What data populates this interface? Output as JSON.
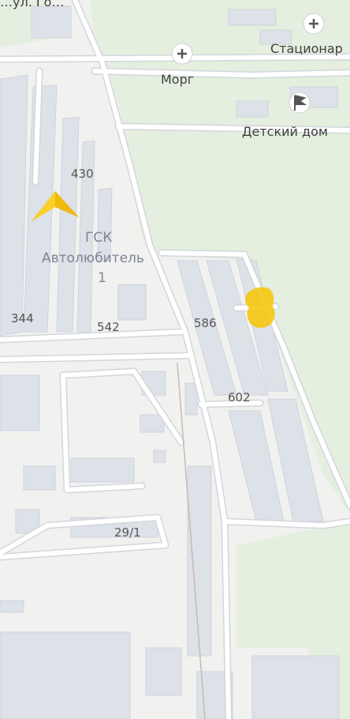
{
  "map": {
    "colors": {
      "background": "#f1f1ef",
      "park": "#e4efdf",
      "road": "#ffffff",
      "road_edge": "#d3d6dc",
      "building": "#dde1e8",
      "marker": "#f5c60f"
    },
    "top_street_fragment": "…ул. Го…",
    "pois": [
      {
        "label": "Стационар",
        "icon": "plus-icon"
      },
      {
        "label": "Морг",
        "icon": "plus-icon"
      },
      {
        "label": "Детский дом",
        "icon": "flag-icon"
      }
    ],
    "area_label": {
      "line1": "ГСК",
      "line2": "Автолюбитель",
      "line3": "1"
    },
    "house_numbers": [
      "430",
      "344",
      "542",
      "586",
      "602",
      "29/1"
    ],
    "location_arrow": "navigation-arrow-icon",
    "marker": "selected-place-marker"
  }
}
